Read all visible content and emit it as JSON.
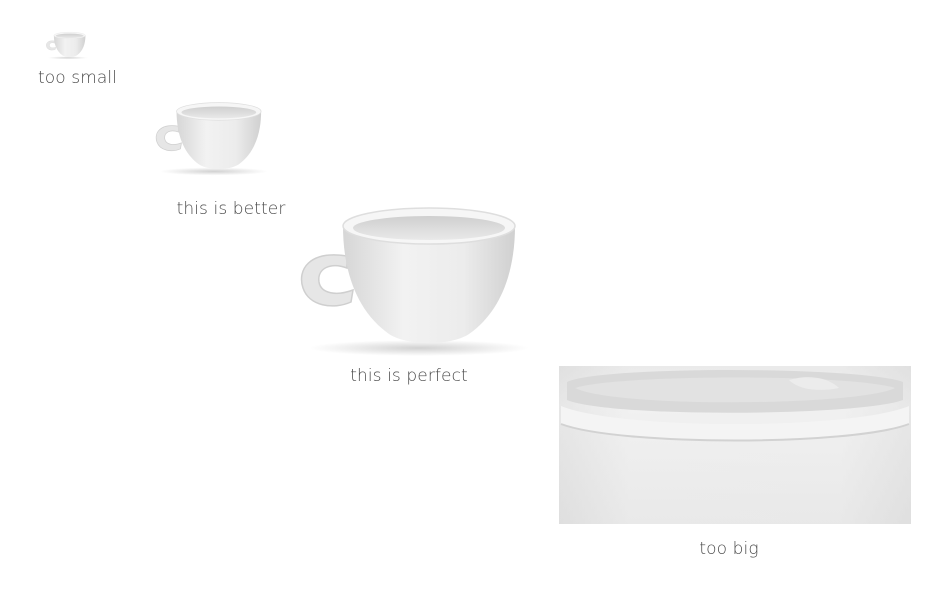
{
  "captions": {
    "small": "too small",
    "better": "this is better",
    "perfect": "this is perfect",
    "big": "too big"
  },
  "colors": {
    "background": "#ffffff",
    "caption_text": "#4a4a4a",
    "cup_body": "#eeeeee",
    "cup_shadow": "#c9c9c9"
  },
  "images": {
    "cup_icon": "white-teacup-icon"
  }
}
